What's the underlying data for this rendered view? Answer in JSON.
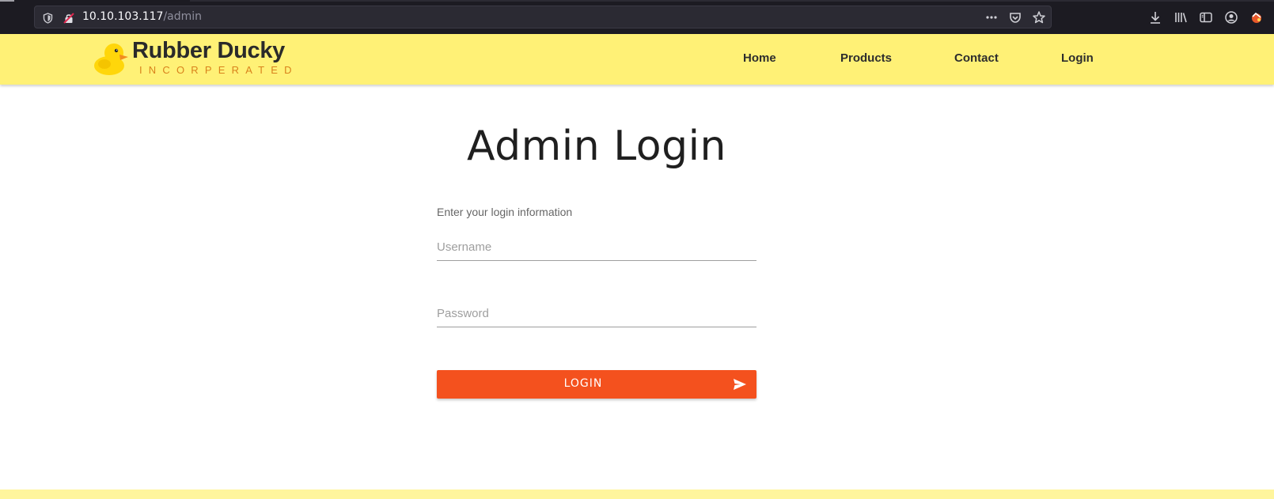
{
  "browser": {
    "url_host": "10.10.103.117",
    "url_path": "/admin",
    "icons": [
      "shield-icon",
      "insecure-lock-icon",
      "more-icon",
      "pocket-icon",
      "bookmark-star-icon",
      "download-icon",
      "library-icon",
      "sidebar-icon",
      "account-icon",
      "extension-icon"
    ]
  },
  "site": {
    "brand_name": "Rubber Ducky",
    "brand_sub": "INCORPERATED",
    "nav": [
      "Home",
      "Products",
      "Contact",
      "Login"
    ],
    "header_color": "#fff176"
  },
  "main": {
    "title": "Admin Login",
    "instruction": "Enter your login information",
    "username_placeholder": "Username",
    "password_placeholder": "Password",
    "login_label": "LOGIN",
    "accent_color": "#f4511e"
  }
}
